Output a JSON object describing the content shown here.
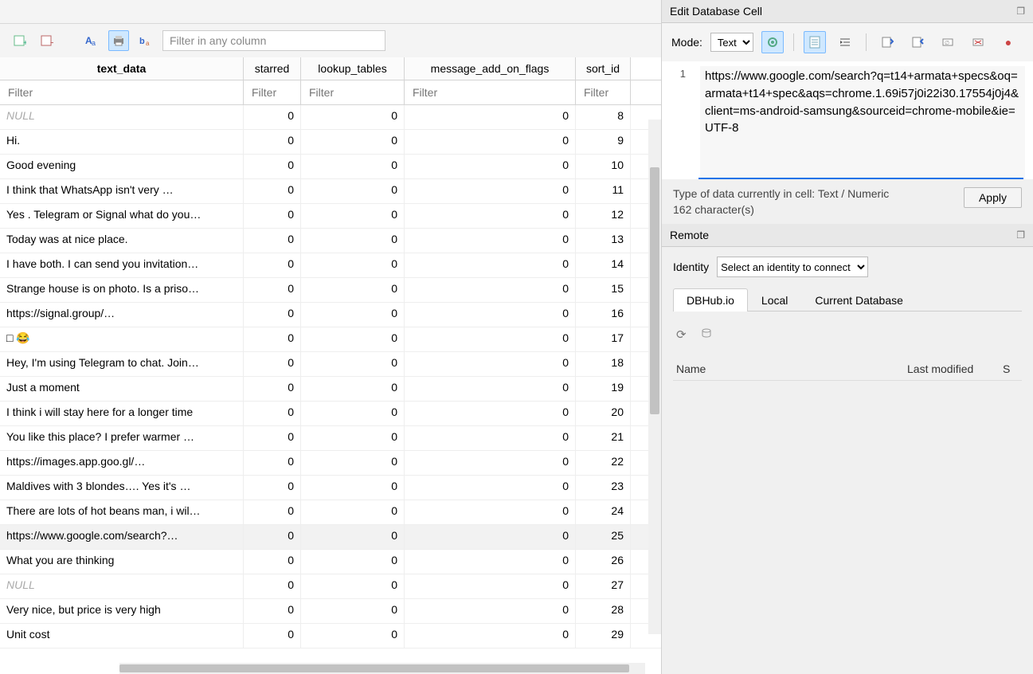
{
  "toolbar": {
    "filter_placeholder": "Filter in any column"
  },
  "table": {
    "columns": {
      "text": "text_data",
      "starred": "starred",
      "lookup": "lookup_tables",
      "flags": "message_add_on_flags",
      "sort": "sort_id"
    },
    "filter_placeholder": "Filter",
    "rows": [
      {
        "text": "NULL",
        "null": true,
        "starred": 0,
        "lookup": 0,
        "flags": 0,
        "sort": 8
      },
      {
        "text": "Hi.",
        "starred": 0,
        "lookup": 0,
        "flags": 0,
        "sort": 9
      },
      {
        "text": "Good evening",
        "starred": 0,
        "lookup": 0,
        "flags": 0,
        "sort": 10
      },
      {
        "text": "I think that WhatsApp isn't very …",
        "starred": 0,
        "lookup": 0,
        "flags": 0,
        "sort": 11
      },
      {
        "text": "Yes . Telegram or Signal what do you…",
        "starred": 0,
        "lookup": 0,
        "flags": 0,
        "sort": 12
      },
      {
        "text": "Today was at nice place.",
        "starred": 0,
        "lookup": 0,
        "flags": 0,
        "sort": 13
      },
      {
        "text": "I have both. I can send you invitation…",
        "starred": 0,
        "lookup": 0,
        "flags": 0,
        "sort": 14
      },
      {
        "text": "Strange house is on photo. Is a priso…",
        "starred": 0,
        "lookup": 0,
        "flags": 0,
        "sort": 15
      },
      {
        "text": "https://signal.group/…",
        "starred": 0,
        "lookup": 0,
        "flags": 0,
        "sort": 16
      },
      {
        "text": "□ 😂",
        "starred": 0,
        "lookup": 0,
        "flags": 0,
        "sort": 17
      },
      {
        "text": "Hey, I'm using Telegram to chat. Join…",
        "starred": 0,
        "lookup": 0,
        "flags": 0,
        "sort": 18
      },
      {
        "text": "Just a moment",
        "starred": 0,
        "lookup": 0,
        "flags": 0,
        "sort": 19
      },
      {
        "text": "I think i will stay here for a longer time",
        "starred": 0,
        "lookup": 0,
        "flags": 0,
        "sort": 20
      },
      {
        "text": "You like this place? I prefer warmer …",
        "starred": 0,
        "lookup": 0,
        "flags": 0,
        "sort": 21
      },
      {
        "text": "https://images.app.goo.gl/…",
        "starred": 0,
        "lookup": 0,
        "flags": 0,
        "sort": 22
      },
      {
        "text": "Maldives with 3 blondes…. Yes it's …",
        "starred": 0,
        "lookup": 0,
        "flags": 0,
        "sort": 23
      },
      {
        "text": "There are lots of hot beans man, i wil…",
        "starred": 0,
        "lookup": 0,
        "flags": 0,
        "sort": 24
      },
      {
        "text": "https://www.google.com/search?…",
        "starred": 0,
        "lookup": 0,
        "flags": 0,
        "sort": 25,
        "selected": true
      },
      {
        "text": "What you are thinking",
        "starred": 0,
        "lookup": 0,
        "flags": 0,
        "sort": 26
      },
      {
        "text": "NULL",
        "null": true,
        "starred": 0,
        "lookup": 0,
        "flags": 0,
        "sort": 27
      },
      {
        "text": "Very nice, but price is very high",
        "starred": 0,
        "lookup": 0,
        "flags": 0,
        "sort": 28
      },
      {
        "text": "Unit cost",
        "starred": 0,
        "lookup": 0,
        "flags": 0,
        "sort": 29
      }
    ]
  },
  "editor": {
    "panel_title": "Edit Database Cell",
    "mode_label": "Mode:",
    "mode_value": "Text",
    "line_no": "1",
    "content": "https://www.google.com/search?q=t14+armata+specs&oq=armata+t14+spec&aqs=chrome.1.69i57j0i22i30.17554j0j4&client=ms-android-samsung&sourceid=chrome-mobile&ie=UTF-8",
    "type_info": "Type of data currently in cell: Text / Numeric",
    "char_count": "162 character(s)",
    "apply": "Apply"
  },
  "remote": {
    "panel_title": "Remote",
    "identity_label": "Identity",
    "identity_placeholder": "Select an identity to connect",
    "tabs": {
      "dbhub": "DBHub.io",
      "local": "Local",
      "current": "Current Database"
    },
    "columns": {
      "name": "Name",
      "modified": "Last modified",
      "s": "S"
    }
  }
}
